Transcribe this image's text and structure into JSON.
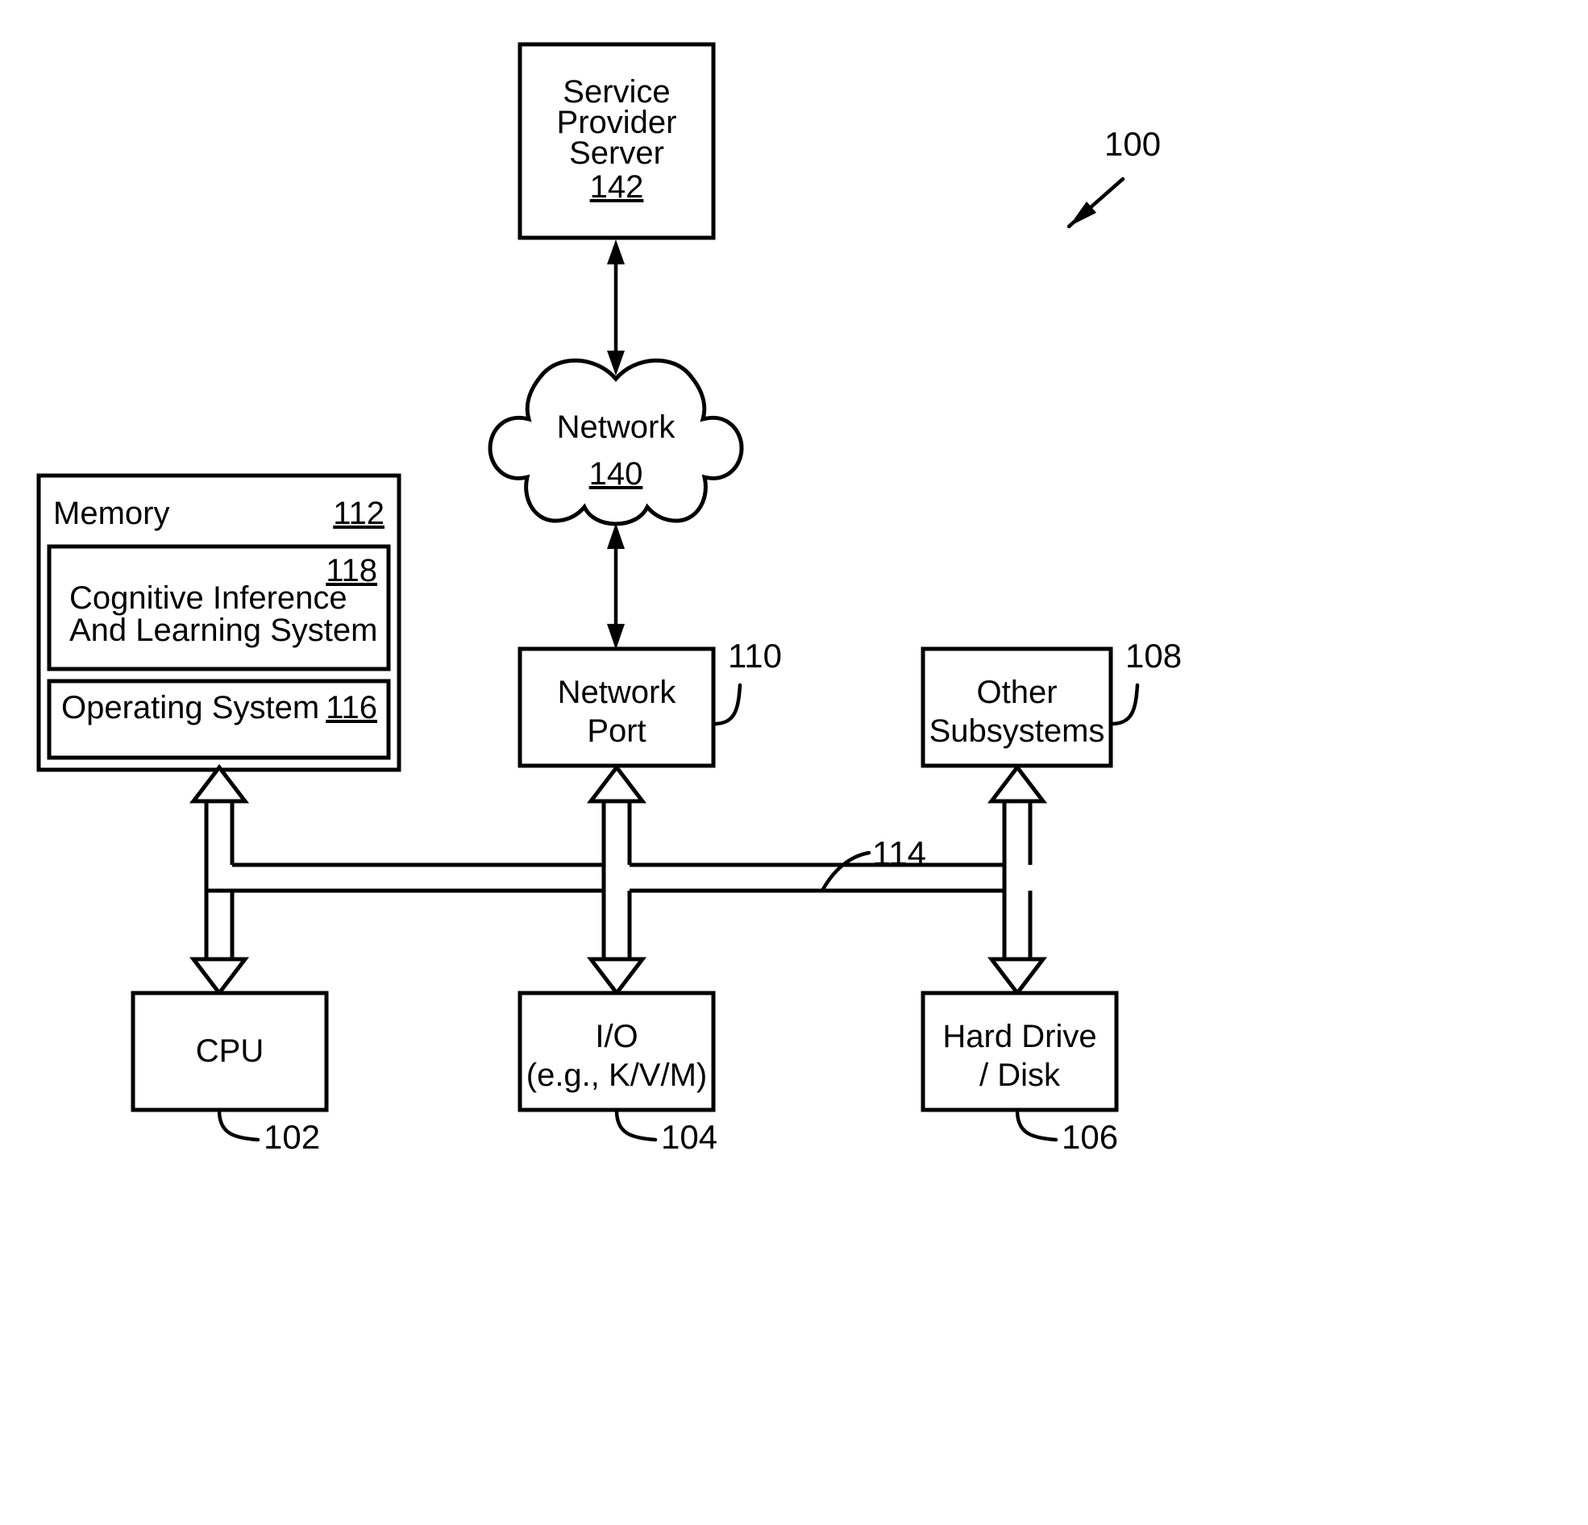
{
  "figure": {
    "reference_numeral": "100",
    "nodes": {
      "service_provider_server": {
        "label_line1": "Service",
        "label_line2": "Provider",
        "label_line3": "Server",
        "ref": "142"
      },
      "network_cloud": {
        "label": "Network",
        "ref": "140"
      },
      "memory": {
        "label": "Memory",
        "ref": "112",
        "inner": {
          "cognitive_inference": {
            "label_line1": "Cognitive Inference",
            "label_line2": "And Learning System",
            "ref": "118"
          },
          "operating_system": {
            "label": "Operating System",
            "ref": "116"
          }
        }
      },
      "network_port": {
        "label_line1": "Network",
        "label_line2": "Port",
        "ref": "110"
      },
      "other_subsystems": {
        "label_line1": "Other",
        "label_line2": "Subsystems",
        "ref": "108"
      },
      "cpu": {
        "label": "CPU",
        "ref": "102"
      },
      "io": {
        "label_line1": "I/O",
        "label_line2": "(e.g., K/V/M)",
        "ref": "104"
      },
      "hard_drive": {
        "label_line1": "Hard Drive",
        "label_line2": "/ Disk",
        "ref": "106"
      },
      "bus": {
        "ref": "114"
      }
    },
    "colors": {
      "line": "#000000",
      "fill": "#ffffff"
    }
  }
}
